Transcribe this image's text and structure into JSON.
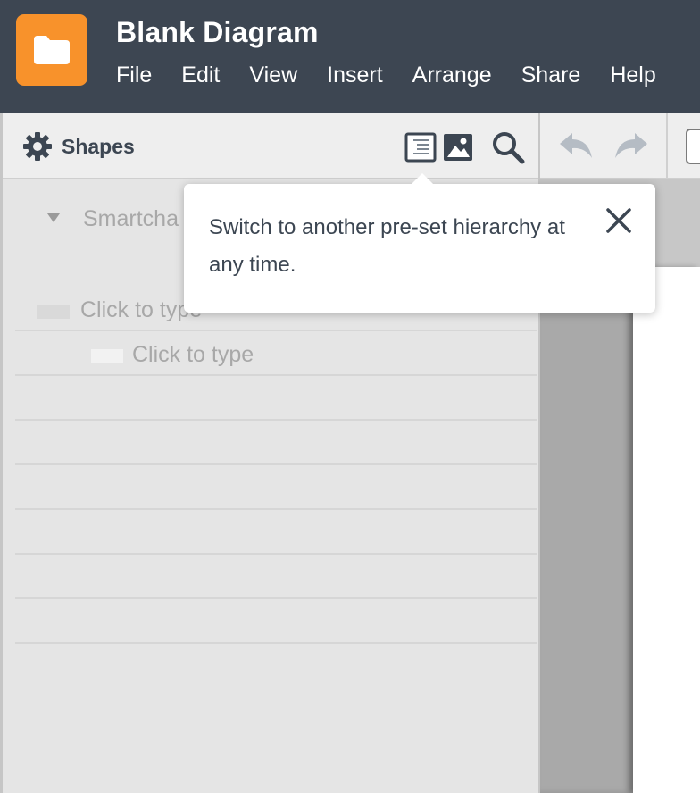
{
  "header": {
    "title": "Blank Diagram",
    "menu": [
      "File",
      "Edit",
      "View",
      "Insert",
      "Arrange",
      "Share",
      "Help"
    ]
  },
  "panel": {
    "title": "Shapes",
    "smartchart_label": "Smartcha",
    "nodes": [
      {
        "text": "Click to type",
        "level": 0
      },
      {
        "text": "Click to type",
        "level": 1
      }
    ]
  },
  "tooltip": {
    "text": "Switch to another pre-set hierarchy at any time."
  },
  "icons": {
    "logo": "folder-icon",
    "panel_header": "gear-icon",
    "outline": "outline-view-icon",
    "image": "image-icon",
    "search": "search-icon",
    "undo": "undo-icon",
    "redo": "redo-icon",
    "close": "close-icon"
  },
  "colors": {
    "header_bg": "#3d4652",
    "logo_bg": "#f8922b",
    "panel_bg": "#e5e5e5",
    "text_dark": "#3c4652",
    "muted_text": "#a8a8a8"
  }
}
